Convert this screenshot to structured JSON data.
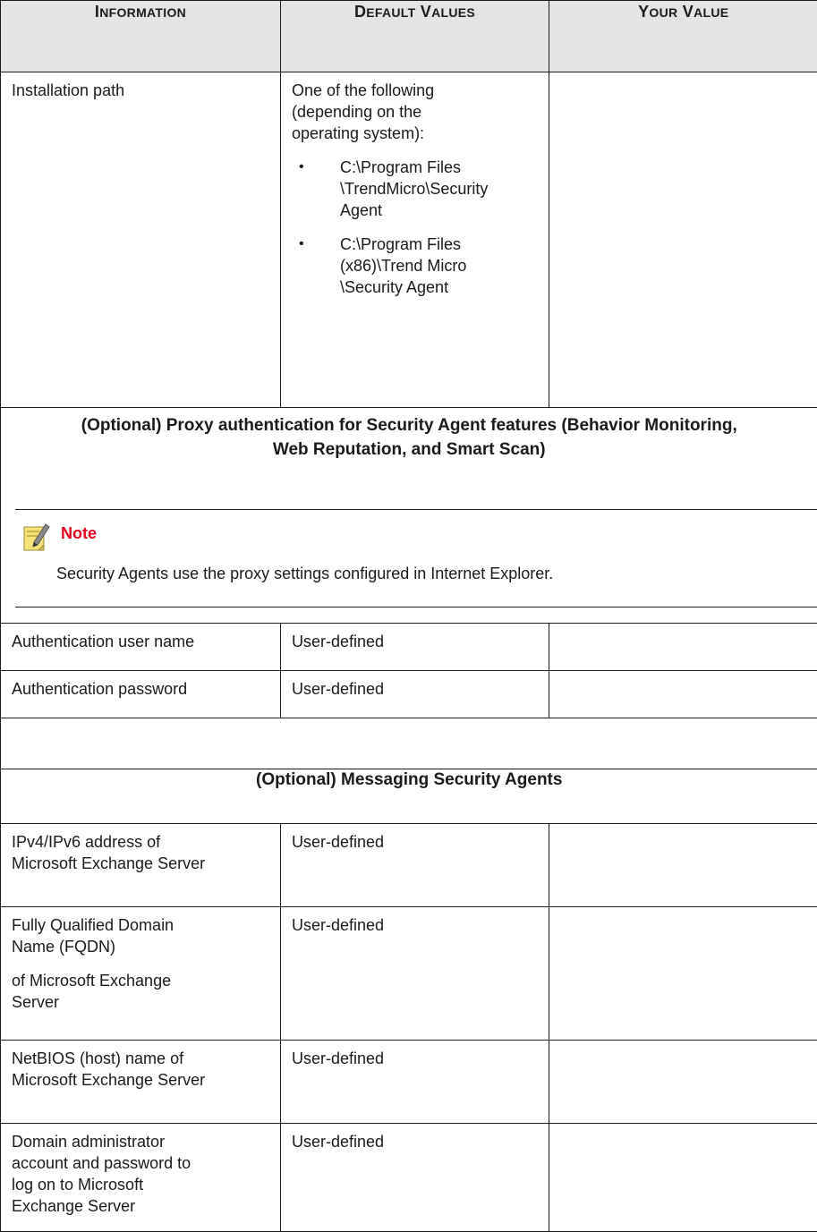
{
  "header": {
    "col1": {
      "first": "I",
      "rest": "NFORMATION"
    },
    "col2": {
      "first_a": "D",
      "rest_a": "EFAULT",
      "first_b": "V",
      "rest_b": "ALUES"
    },
    "col3": {
      "first_a": "Y",
      "rest_a": "OUR",
      "first_b": "V",
      "rest_b": "ALUE"
    }
  },
  "install_row": {
    "information": "Installation path",
    "default_intro": [
      "One of the following",
      "(depending on the",
      "operating system):"
    ],
    "paths": [
      [
        "C:\\Program Files",
        "\\TrendMicro\\Security",
        "Agent"
      ],
      [
        "C:\\Program Files",
        "(x86)\\Trend Micro",
        "\\Security Agent"
      ]
    ],
    "bullet": "•"
  },
  "proxy_section": {
    "heading_line1": "(Optional) Proxy authentication for Security Agent features (Behavior Monitoring,",
    "heading_line2": "Web Reputation, and Smart Scan)",
    "note_title": "Note",
    "note_body": "Security Agents use the proxy settings configured in Internet Explorer.",
    "note_icon": "note-pencil-icon"
  },
  "proxy_rows": [
    {
      "information": "Authentication user name",
      "default": "User-defined"
    },
    {
      "information": "Authentication password",
      "default": "User-defined"
    }
  ],
  "msa_section": {
    "heading": "(Optional) Messaging Security Agents"
  },
  "msa_rows": {
    "ip": {
      "lines": [
        "IPv4/IPv6 address of",
        "Microsoft Exchange Server"
      ],
      "default": "User-defined"
    },
    "fqdn": {
      "lines_a": [
        "Fully Qualified Domain",
        "Name (FQDN)"
      ],
      "lines_b": [
        "of Microsoft Exchange",
        "Server"
      ],
      "default": "User-defined"
    },
    "netbios": {
      "lines": [
        "NetBIOS (host) name of",
        "Microsoft Exchange Server"
      ],
      "default": "User-defined"
    },
    "domain": {
      "lines": [
        "Domain administrator",
        "account and password to",
        "log on to Microsoft",
        "Exchange Server"
      ],
      "default": "User-defined"
    }
  },
  "colors": {
    "header_bg": "#e4e4e4",
    "note_red": "#e2001a",
    "note_icon_yellow": "#f7e27a"
  }
}
